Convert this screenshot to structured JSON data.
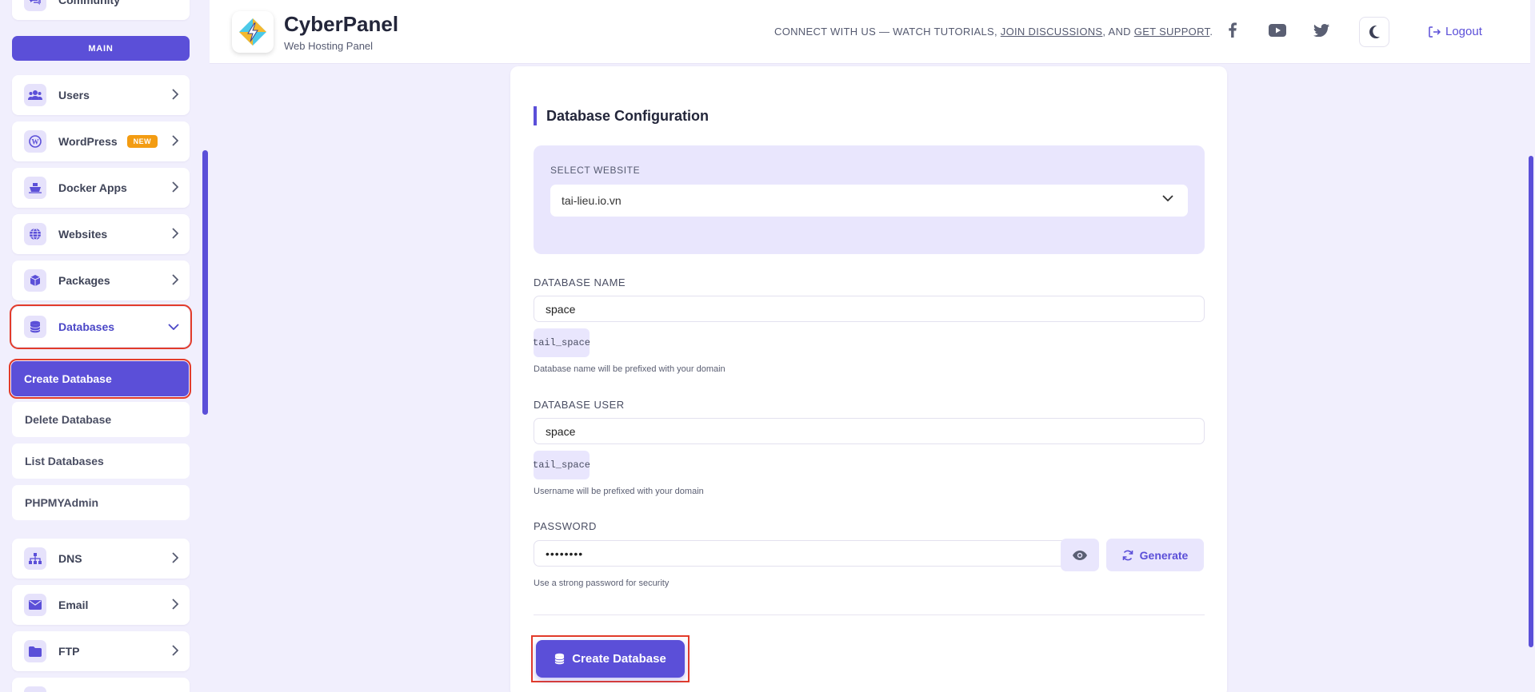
{
  "sidebar": {
    "top_item": "Community",
    "section_label": "MAIN",
    "items": [
      {
        "label": "Users",
        "icon": "users-icon"
      },
      {
        "label": "WordPress",
        "icon": "wordpress-icon",
        "badge": "NEW"
      },
      {
        "label": "Docker Apps",
        "icon": "docker-icon"
      },
      {
        "label": "Websites",
        "icon": "globe-icon"
      },
      {
        "label": "Packages",
        "icon": "package-icon"
      },
      {
        "label": "Databases",
        "icon": "database-icon"
      },
      {
        "label": "DNS",
        "icon": "sitemap-icon"
      },
      {
        "label": "Email",
        "icon": "envelope-icon"
      },
      {
        "label": "FTP",
        "icon": "folder-icon"
      }
    ],
    "db_submenu": [
      "Create Database",
      "Delete Database",
      "List Databases",
      "PHPMYAdmin"
    ]
  },
  "header": {
    "brand": "CyberPanel",
    "brand_sub": "Web Hosting Panel",
    "connect_prefix": "CONNECT WITH US — WATCH TUTORIALS, ",
    "join_link": "JOIN DISCUSSIONS",
    "connect_mid": ", AND ",
    "support_link": "GET SUPPORT",
    "connect_end": ".",
    "logout": "Logout"
  },
  "form": {
    "title": "Database Configuration",
    "select_label": "SELECT WEBSITE",
    "select_value": "tai-lieu.io.vn",
    "db_name_label": "DATABASE NAME",
    "db_name_value": "space",
    "db_name_prefix": "tail_space",
    "db_name_hint": "Database name will be prefixed with your domain",
    "db_user_label": "DATABASE USER",
    "db_user_value": "space",
    "db_user_prefix": "tail_space",
    "db_user_hint": "Username will be prefixed with your domain",
    "password_label": "PASSWORD",
    "password_value": "••••••••",
    "generate_label": "Generate",
    "password_hint": "Use a strong password for security",
    "submit_label": "Create Database"
  },
  "colors": {
    "accent": "#5b4fd8",
    "highlight": "#e23b2a",
    "badge": "#f39c12"
  }
}
